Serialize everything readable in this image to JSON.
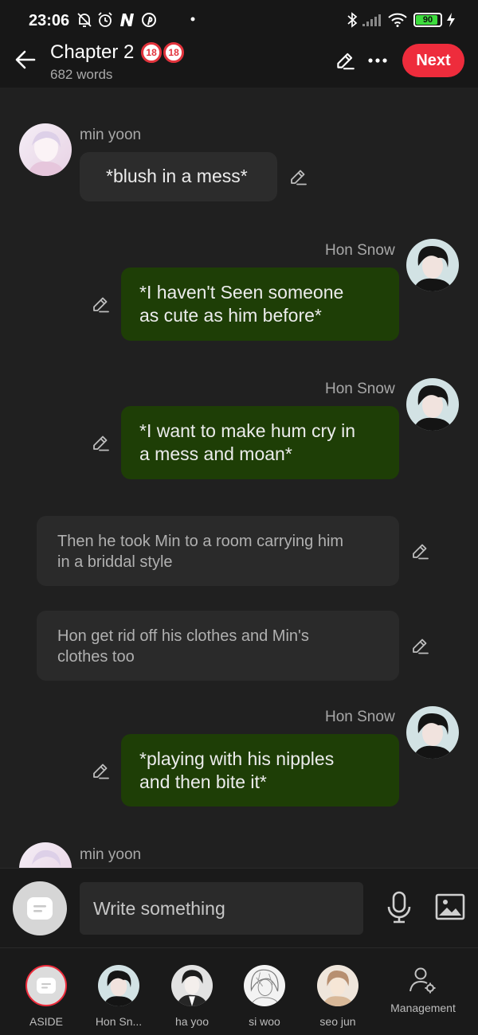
{
  "status_bar": {
    "time": "23:06",
    "battery": "90",
    "battery_level": 0.9,
    "icons": [
      "bell-off-icon",
      "alarm-icon",
      "n-app-icon",
      "pinterest-icon",
      "dot-icon",
      "bluetooth-icon",
      "signal-icon",
      "wifi-icon",
      "battery-icon",
      "charging-icon"
    ]
  },
  "header": {
    "title": "Chapter 2",
    "badges": [
      "18",
      "18"
    ],
    "word_count": "682 words",
    "next_label": "Next",
    "icons": [
      "back-arrow-icon",
      "pencil-icon",
      "more-icon"
    ]
  },
  "messages": [
    {
      "type": "character",
      "side": "left",
      "sender": "min yoon",
      "text": "*blush in a mess*"
    },
    {
      "type": "character",
      "side": "right",
      "sender": "Hon Snow",
      "lines": [
        "*I haven't Seen someone",
        "as cute as him before*"
      ]
    },
    {
      "type": "character",
      "side": "right",
      "sender": "Hon Snow",
      "lines": [
        "*I want to make hum cry in",
        "a mess and moan*"
      ]
    },
    {
      "type": "narration",
      "lines": [
        "Then he took Min to a room carrying him",
        "in a briddal style"
      ]
    },
    {
      "type": "narration",
      "lines": [
        "Hon get rid off his clothes and Min's",
        "clothes too"
      ]
    },
    {
      "type": "character",
      "side": "right",
      "sender": "Hon Snow",
      "lines": [
        "*playing with his nipples",
        "and then bite it*"
      ]
    },
    {
      "type": "character",
      "side": "left",
      "sender": "min yoon",
      "text": ""
    }
  ],
  "composer": {
    "placeholder": "Write something",
    "icons": [
      "aside-chat-icon",
      "microphone-icon",
      "image-icon"
    ]
  },
  "characters": [
    {
      "name": "ASIDE",
      "icon": "aside-chat-icon"
    },
    {
      "name": "Hon Sn...",
      "icon": "avatar"
    },
    {
      "name": "ha yoo",
      "icon": "avatar"
    },
    {
      "name": "si woo",
      "icon": "avatar"
    },
    {
      "name": "seo jun",
      "icon": "avatar"
    },
    {
      "name": "Management",
      "icon": "user-settings-icon"
    }
  ],
  "colors": {
    "background": "#202020",
    "accent_red": "#ee2c3c",
    "user_bubble": "#1e3e06",
    "other_bubble": "#2c2c2c"
  }
}
